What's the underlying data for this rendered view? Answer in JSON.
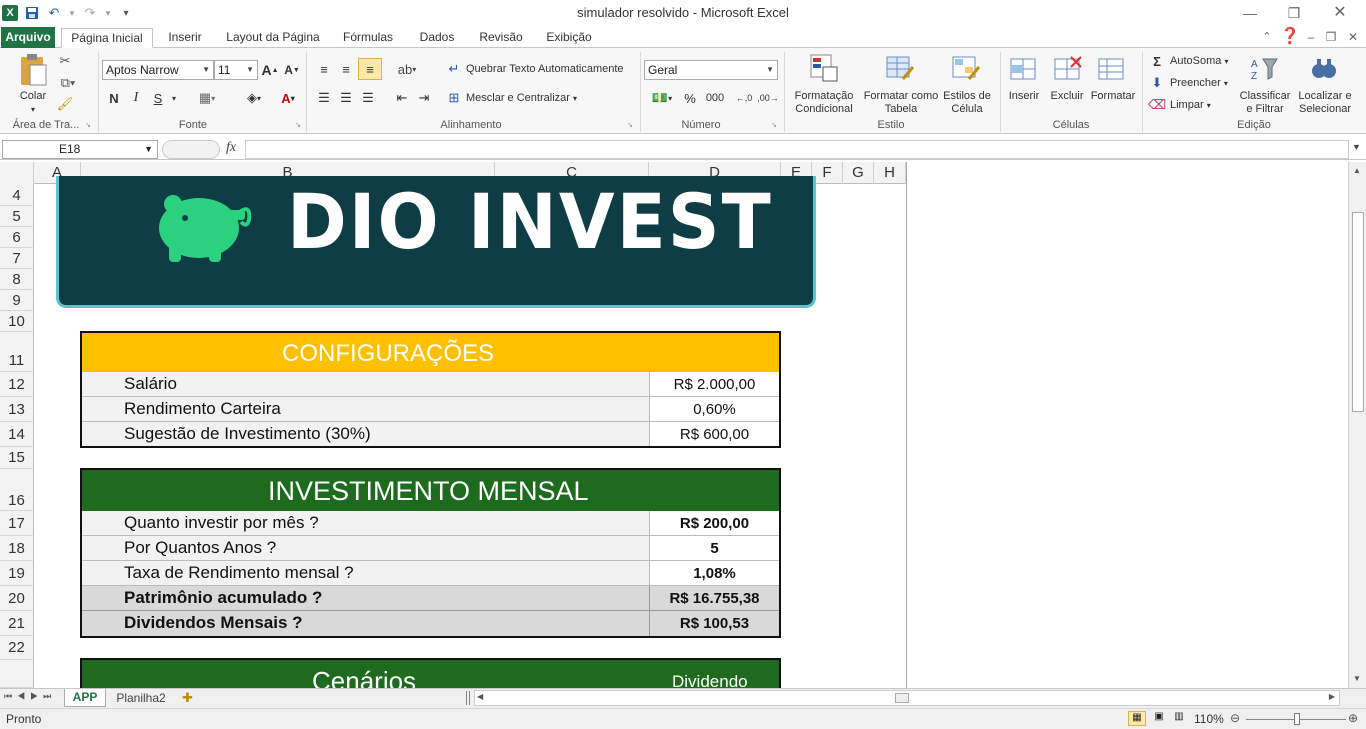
{
  "window": {
    "title": "simulador resolvido  -  Microsoft Excel",
    "logo": "X"
  },
  "tabs": {
    "file": "Arquivo",
    "items": [
      "Página Inicial",
      "Inserir",
      "Layout da Página",
      "Fórmulas",
      "Dados",
      "Revisão",
      "Exibição"
    ]
  },
  "ribbon": {
    "clipboard": {
      "paste": "Colar",
      "label": "Área de Tra..."
    },
    "font": {
      "name": "Aptos Narrow",
      "size": "11",
      "bold": "N",
      "italic": "I",
      "underline": "S",
      "label": "Fonte"
    },
    "alignment": {
      "wrap": "Quebrar Texto Automaticamente",
      "merge": "Mesclar e Centralizar",
      "label": "Alinhamento"
    },
    "number": {
      "format": "Geral",
      "percent": "%",
      "thousands": "000",
      "label": "Número"
    },
    "styles": {
      "conditional": "Formatação Condicional",
      "table": "Formatar como Tabela",
      "cell_styles": "Estilos de Célula",
      "label": "Estilo"
    },
    "cells": {
      "insert": "Inserir",
      "delete": "Excluir",
      "format": "Formatar",
      "label": "Células"
    },
    "editing": {
      "autosum": "AutoSoma",
      "fill": "Preencher",
      "clear": "Limpar",
      "sort": "Classificar e Filtrar",
      "find": "Localizar e Selecionar",
      "label": "Edição"
    }
  },
  "formula_bar": {
    "name_box": "E18",
    "fx": "fx",
    "value": ""
  },
  "columns": [
    "A",
    "B",
    "C",
    "D",
    "E",
    "F",
    "G",
    "H"
  ],
  "rows": [
    "4",
    "5",
    "6",
    "7",
    "8",
    "9",
    "10",
    "11",
    "12",
    "13",
    "14",
    "15",
    "16",
    "17",
    "18",
    "19",
    "20",
    "21",
    "22"
  ],
  "banner": {
    "title": "DIO INVEST"
  },
  "config": {
    "header": "CONFIGURAÇÕES",
    "rows": [
      {
        "label": "Salário",
        "value": "R$ 2.000,00"
      },
      {
        "label": "Rendimento Carteira",
        "value": "0,60%"
      },
      {
        "label": "Sugestão de Investimento (30%)",
        "value": "R$ 600,00"
      }
    ]
  },
  "monthly": {
    "header": "INVESTIMENTO MENSAL",
    "rows": [
      {
        "label": "Quanto investir por mês ?",
        "value": "R$ 200,00"
      },
      {
        "label": "Por Quantos Anos ?",
        "value": "5"
      },
      {
        "label": "Taxa de Rendimento mensal ?",
        "value": "1,08%"
      },
      {
        "label": "Patrimônio acumulado ?",
        "value": "R$ 16.755,38"
      },
      {
        "label": "Dividendos Mensais ?",
        "value": "R$ 100,53"
      }
    ]
  },
  "scenarios": {
    "header": "Cenários",
    "col": "Dividendo"
  },
  "sheets": {
    "active": "APP",
    "other": "Planilha2"
  },
  "status": {
    "text": "Pronto",
    "zoom": "110%"
  },
  "colors": {
    "excel_green": "#217346",
    "banner": "#0e3d45",
    "pig": "#2ad17e",
    "config_header": "#ffc000",
    "monthly_header": "#1e6b20",
    "row_gray": "#f2f2f2",
    "total_gray": "#d9d9d9"
  }
}
